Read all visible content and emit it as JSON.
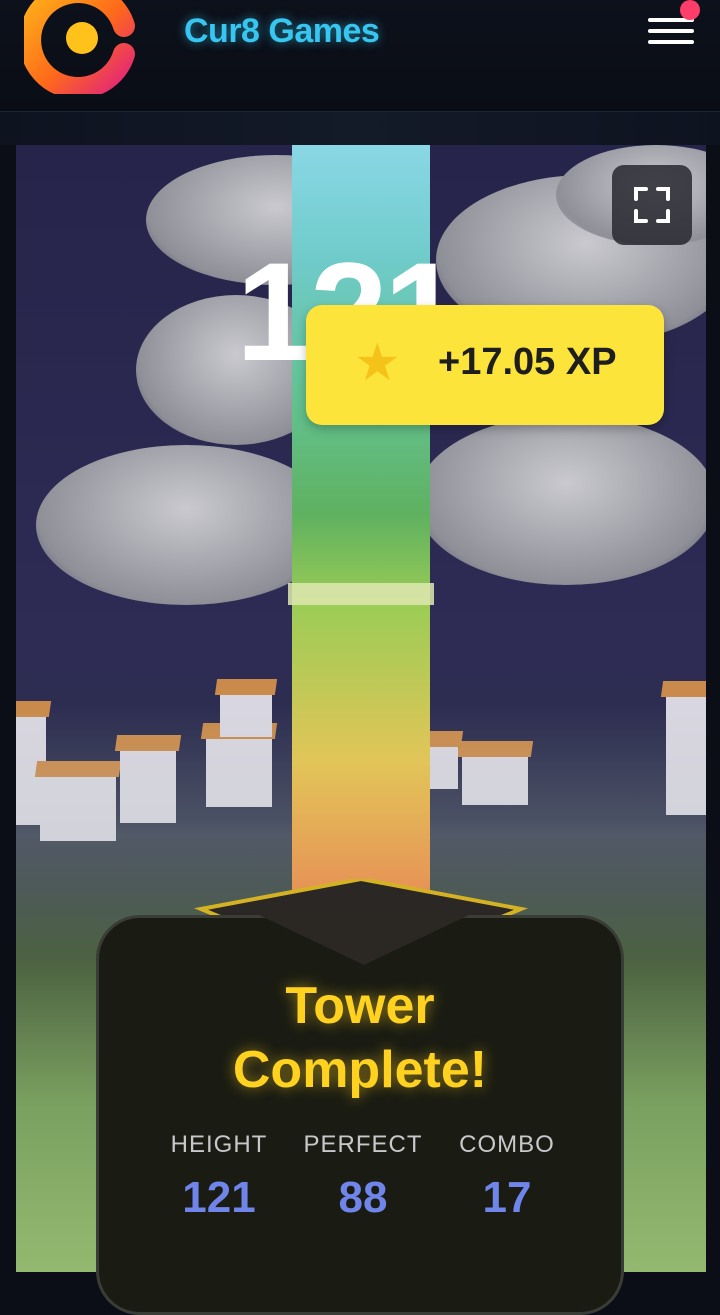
{
  "header": {
    "brand": "Cur8 Games",
    "logo_icon": "cur8-logo-icon",
    "menu_icon": "hamburger-menu-icon",
    "notification_color": "#ff3d6b",
    "brand_color": "#36c6f0"
  },
  "game": {
    "score": "121",
    "fullscreen_icon": "fullscreen-icon",
    "xp_toast": {
      "icon": "star-icon",
      "text": "+17.05 XP",
      "color": "#fde43a"
    },
    "result": {
      "title_line1": "Tower",
      "title_line2": "Complete!",
      "stats": [
        {
          "label": "HEIGHT",
          "value": "121"
        },
        {
          "label": "PERFECT",
          "value": "88"
        },
        {
          "label": "COMBO",
          "value": "17"
        }
      ],
      "title_color": "#ffd21f",
      "value_color": "#7085ea"
    }
  }
}
